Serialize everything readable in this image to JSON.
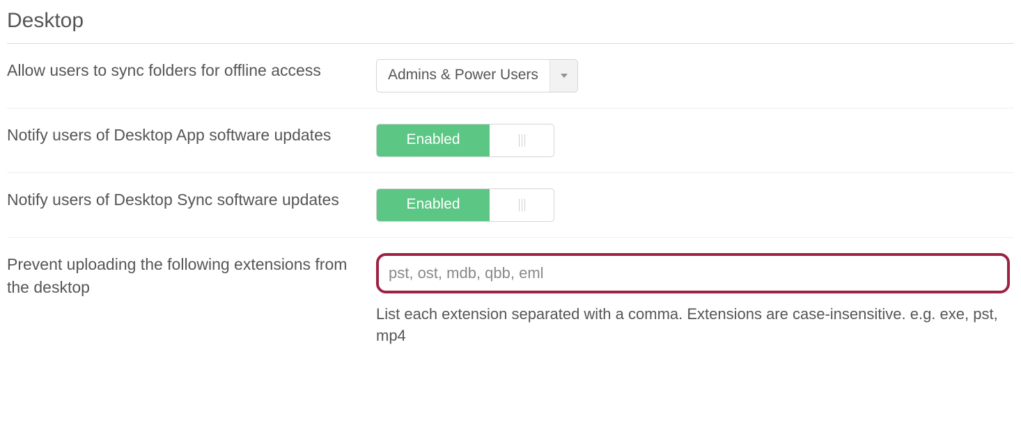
{
  "section": {
    "title": "Desktop"
  },
  "rows": {
    "sync": {
      "label": "Allow users to sync folders for offline access",
      "dropdown_value": "Admins & Power Users"
    },
    "app_updates": {
      "label": "Notify users of Desktop App software updates",
      "toggle_state": "Enabled"
    },
    "sync_updates": {
      "label": "Notify users of Desktop Sync software updates",
      "toggle_state": "Enabled"
    },
    "extensions": {
      "label": "Prevent uploading the following extensions from the desktop",
      "input_value": "pst, ost, mdb, qbb, eml",
      "help": "List each extension separated with a comma. Extensions are case-insensitive. e.g. exe, pst, mp4"
    }
  }
}
